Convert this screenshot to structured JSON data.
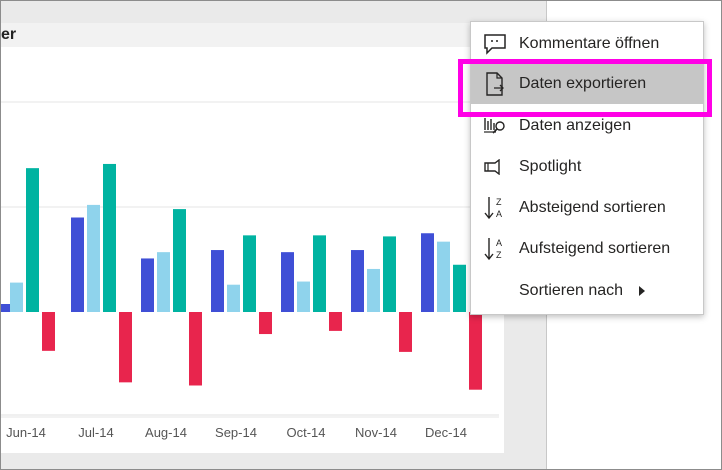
{
  "visual": {
    "title_fragment": "er"
  },
  "chart_data": {
    "type": "bar",
    "categories": [
      "Jun-14",
      "Jul-14",
      "Aug-14",
      "Sep-14",
      "Oct-14",
      "Nov-14",
      "Dec-14"
    ],
    "series": [
      {
        "color": "#3f4fd6",
        "values": [
          null,
          90,
          51,
          59,
          57,
          59,
          75
        ]
      },
      {
        "color": "#8fd3ec",
        "values": [
          28,
          102,
          57,
          26,
          29,
          41,
          67
        ]
      },
      {
        "color": "#00b3a1",
        "values": [
          137,
          141,
          98,
          73,
          73,
          72,
          45
        ]
      },
      {
        "color": "#e8254d",
        "values": [
          -37,
          -67,
          -70,
          -21,
          -18,
          -38,
          -74
        ]
      }
    ],
    "ylim": [
      -100,
      200
    ],
    "grid": true
  },
  "menu": {
    "items": [
      {
        "label": "Kommentare öffnen",
        "icon": "comment-icon"
      },
      {
        "label": "Daten exportieren",
        "icon": "export-data-icon"
      },
      {
        "label": "Daten anzeigen",
        "icon": "view-data-icon"
      },
      {
        "label": "Spotlight",
        "icon": "spotlight-icon"
      },
      {
        "label": "Absteigend sortieren",
        "icon": "sort-descending-icon"
      },
      {
        "label": "Aufsteigend sortieren",
        "icon": "sort-ascending-icon"
      },
      {
        "label": "Sortieren nach",
        "icon": "chevron-right-icon"
      }
    ],
    "highlighted_index": 1,
    "highlight_color": "#ff00e6"
  }
}
